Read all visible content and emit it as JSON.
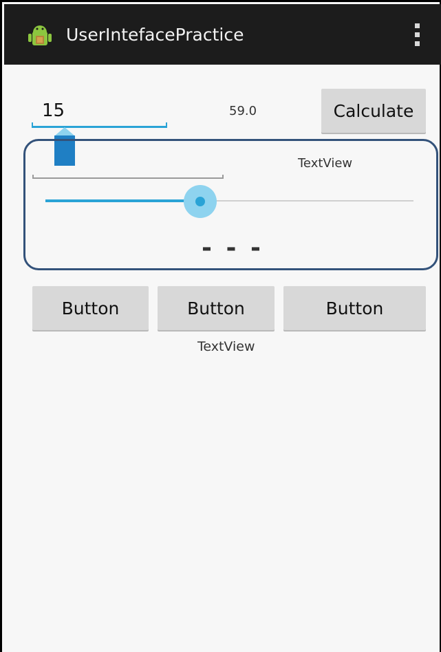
{
  "app": {
    "title": "UserIntefacePractice",
    "icon": "android-robot-icon"
  },
  "actionbar": {
    "overflow_icon": "overflow-menu-icon"
  },
  "form": {
    "edit_value": "15",
    "result_value": "59.0",
    "calculate_label": "Calculate"
  },
  "panel": {
    "textview_label": "TextView",
    "seekbar_progress": 0.42,
    "dash_text": "- - -"
  },
  "buttons": [
    {
      "label": "Button"
    },
    {
      "label": "Button"
    },
    {
      "label": "Button"
    }
  ],
  "bottom_textview": "TextView",
  "colors": {
    "accent": "#2aa3d6",
    "actionbar": "#1c1c1c",
    "highlight_border": "#33527a"
  }
}
